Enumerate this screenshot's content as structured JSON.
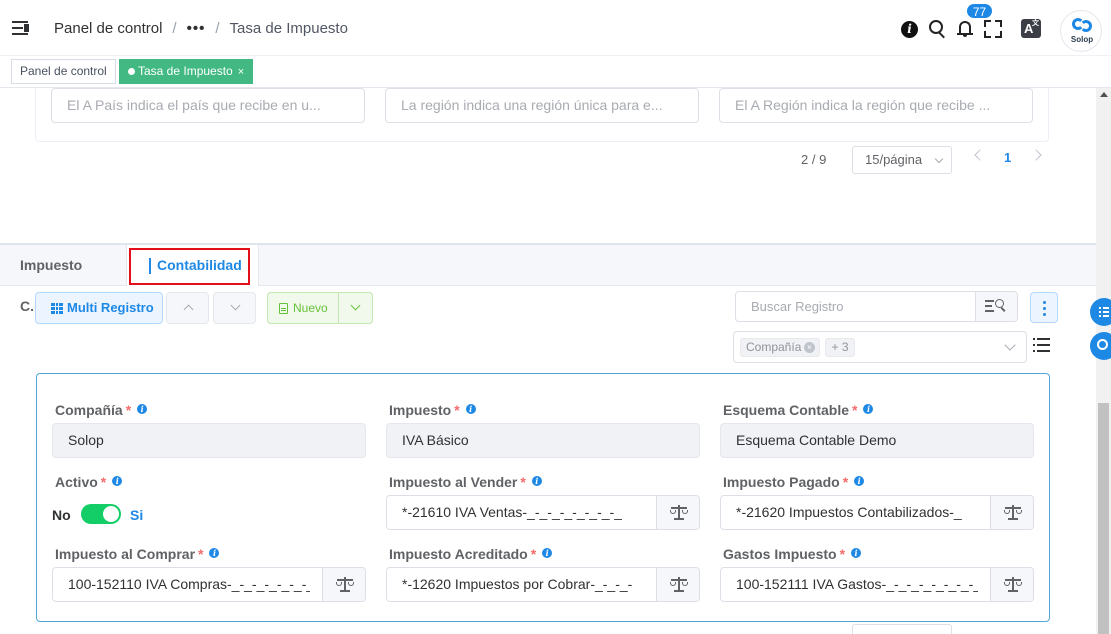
{
  "header": {
    "breadcrumb": {
      "root": "Panel de control",
      "ellipsis": "•••",
      "separator": "/",
      "current": "Tasa de Impuesto"
    },
    "notifications_count": "77",
    "translate_glyph": "A",
    "translate_sup": "文",
    "avatar_text": "Solop",
    "info_glyph": "i",
    "icons": [
      "menu-fold-icon",
      "info-icon",
      "search-icon",
      "bell-icon",
      "fullscreen-icon",
      "translate-icon"
    ]
  },
  "tags": {
    "panel": "Panel de control",
    "active": "Tasa de Impuesto",
    "close": "×",
    "active_color": "#42b983"
  },
  "filters": {
    "country_to_placeholder": "El A País indica el país que recibe en u...",
    "region_placeholder": "La región indica una región única para e...",
    "region_to_placeholder": "El A Región indica la región que recibe ..."
  },
  "pager": {
    "total": "2 / 9",
    "page_size": "15/página",
    "current_page": "1"
  },
  "tabs": [
    {
      "label": "Impuesto C.P."
    },
    {
      "label": "Contabilidad",
      "active": true
    }
  ],
  "toolbar": {
    "multi_record": "Multi Registro",
    "new": "Nuevo",
    "search_placeholder": "Buscar Registro",
    "column_chip": "Compañía",
    "column_chip_close": "×",
    "column_more": "+ 3"
  },
  "form": {
    "company": {
      "label": "Compañía",
      "value": "Solop"
    },
    "tax": {
      "label": "Impuesto",
      "value": "IVA Básico"
    },
    "accounting_schema": {
      "label": "Esquema Contable",
      "value": "Esquema Contable Demo"
    },
    "active": {
      "label": "Activo",
      "off_label": "No",
      "on_label": "Si",
      "value": true
    },
    "tax_due": {
      "label": "Impuesto al Vender",
      "value": "*-21610 IVA Ventas-_-_-_-_-_-_-_-_"
    },
    "tax_liability": {
      "label": "Impuesto Pagado",
      "value": "*-21620 Impuestos Contabilizados-_"
    },
    "tax_credit": {
      "label": "Impuesto al Comprar",
      "value": "100-152110 IVA Compras-_-_-_-_-_-_-_"
    },
    "tax_receivables": {
      "label": "Impuesto Acreditado",
      "value": "*-12620 Impuestos por Cobrar-_-_-_-"
    },
    "tax_expense": {
      "label": "Gastos Impuesto",
      "value": "100-152111 IVA Gastos-_-_-_-_-_-_-_-_"
    },
    "required_mark": "*",
    "info_glyph": "i"
  },
  "colors": {
    "primary": "#1e88e5",
    "success": "#42b983",
    "switch_on": "#13ce66",
    "highlight_box": "#e3101b",
    "form_border": "#4fa7d8"
  }
}
